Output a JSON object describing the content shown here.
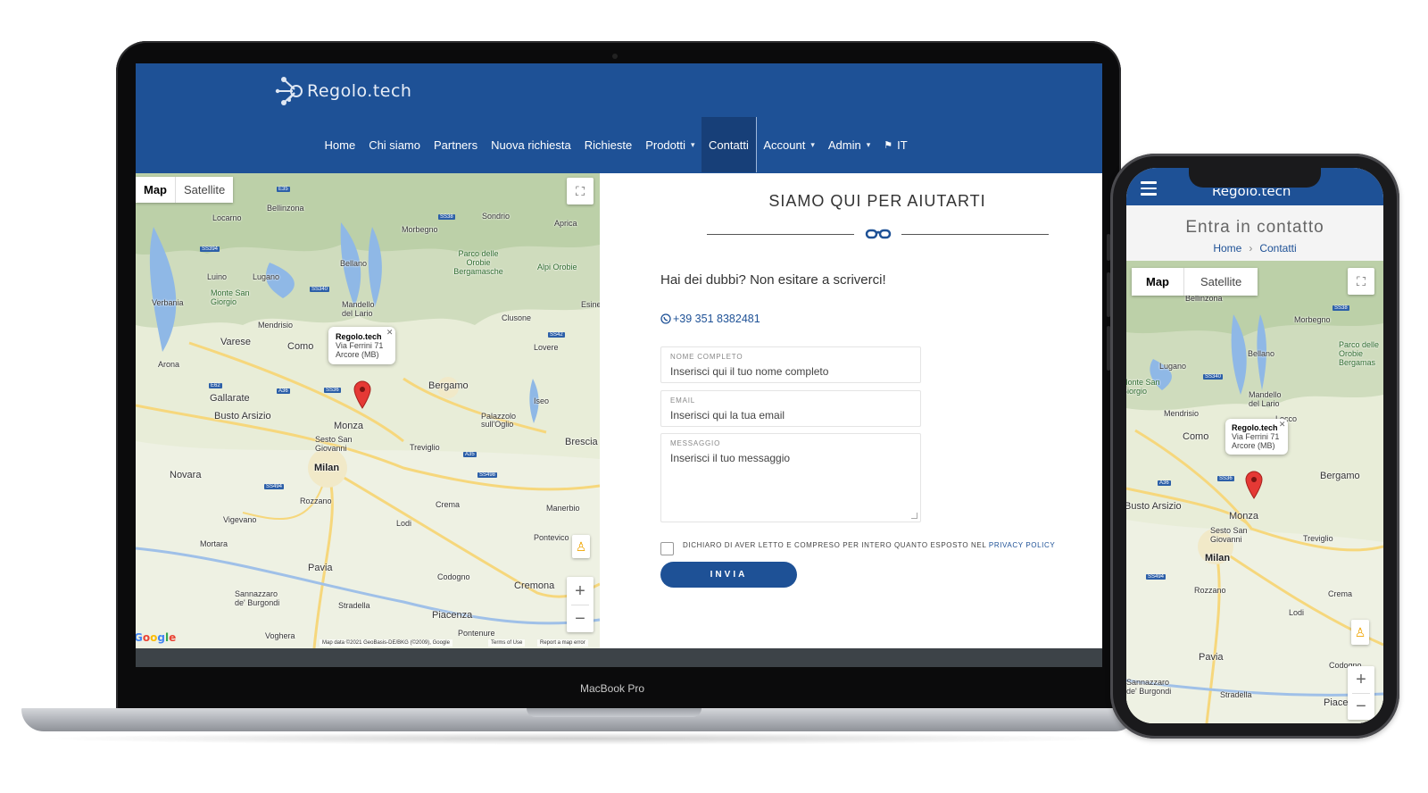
{
  "desktop": {
    "device_label": "MacBook Pro",
    "logo_text": "Regolo.tech",
    "nav": [
      {
        "label": "Home"
      },
      {
        "label": "Chi siamo"
      },
      {
        "label": "Partners"
      },
      {
        "label": "Nuova richiesta"
      },
      {
        "label": "Richieste"
      },
      {
        "label": "Prodotti",
        "dropdown": true
      },
      {
        "label": "Contatti",
        "active": true
      },
      {
        "label": "Account",
        "dropdown": true
      },
      {
        "label": "Admin",
        "dropdown": true
      },
      {
        "label": "IT",
        "icon": "flag-icon"
      }
    ],
    "map": {
      "type_map": "Map",
      "type_satellite": "Satellite",
      "info_title": "Regolo.tech",
      "info_line1": "Via Ferrini 71",
      "info_line2": "Arcore (MB)",
      "google": "Google",
      "attribution": "Map data ©2021 GeoBasis-DE/BKG (©2009), Google",
      "terms": "Terms of Use",
      "report": "Report a map error",
      "labels": [
        "Locarno",
        "Bellinzona",
        "Sondrio",
        "Aprica",
        "Morbegno",
        "Parco delle Orobie Bergamasche",
        "Alpi Orobie",
        "Bellano",
        "Lugano",
        "Luino",
        "Monte San Giorgio",
        "Verbania",
        "Mendrisio",
        "Mandello del Lario",
        "Varese",
        "Como",
        "Clusone",
        "Lovere",
        "Esine",
        "Arona",
        "Bergamo",
        "Gallarate",
        "Busto Arsizio",
        "Iseo",
        "Palazzolo sull'Oglio",
        "Monza",
        "Sesto San Giovanni",
        "Treviglio",
        "Brescia",
        "Milan",
        "Novara",
        "Crema",
        "Rozzano",
        "Manerbio",
        "Vigevano",
        "Lodi",
        "Mortara",
        "Pontevico",
        "Pavia",
        "Codogno",
        "Cremona",
        "Sannazzaro de' Burgondi",
        "Stradella",
        "Piacenza",
        "Voghera",
        "Pontenure"
      ]
    },
    "contact": {
      "title": "SIAMO QUI PER AIUTARTI",
      "subtitle": "Hai dei dubbi? Non esitare a scriverci!",
      "phone": "+39 351 8382481",
      "fields": [
        {
          "label": "NOME COMPLETO",
          "placeholder": "Inserisci qui il tuo nome completo"
        },
        {
          "label": "EMAIL",
          "placeholder": "Inserisci qui la tua email"
        },
        {
          "label": "MESSAGGIO",
          "placeholder": "Inserisci il tuo messaggio"
        }
      ],
      "consent": "DICHIARO DI AVER LETTO E COMPRESO PER INTERO QUANTO ESPOSTO NEL",
      "privacy": "PRIVACY POLICY",
      "submit": "INVIA"
    }
  },
  "mobile": {
    "logo_text": "Regolo.tech",
    "page_title": "Entra in contatto",
    "breadcrumb": {
      "home": "Home",
      "sep": "›",
      "current": "Contatti"
    },
    "map": {
      "type_map": "Map",
      "type_satellite": "Satellite",
      "info_title": "Regolo.tech",
      "info_line1": "Via Ferrini 71",
      "info_line2": "Arcore (MB)",
      "labels": [
        "Bellinzona",
        "Morbegno",
        "Parco delle Orobie Bergamas",
        "Bellano",
        "Lugano",
        "Monte San Giorgio",
        "Mandello del Lario",
        "Mendrisio",
        "Lecco",
        "Como",
        "Bergamo",
        "Busto Arsizio",
        "Monza",
        "Sesto San Giovanni",
        "Treviglio",
        "Milan",
        "Rozzano",
        "Crema",
        "Lodi",
        "Pavia",
        "Codogno",
        "Sannazzaro de' Burgondi",
        "Stradella",
        "Piacenza"
      ]
    }
  },
  "colors": {
    "brand_blue": "#1e5196",
    "nav_active": "#173f78",
    "marker_red": "#e53935"
  }
}
